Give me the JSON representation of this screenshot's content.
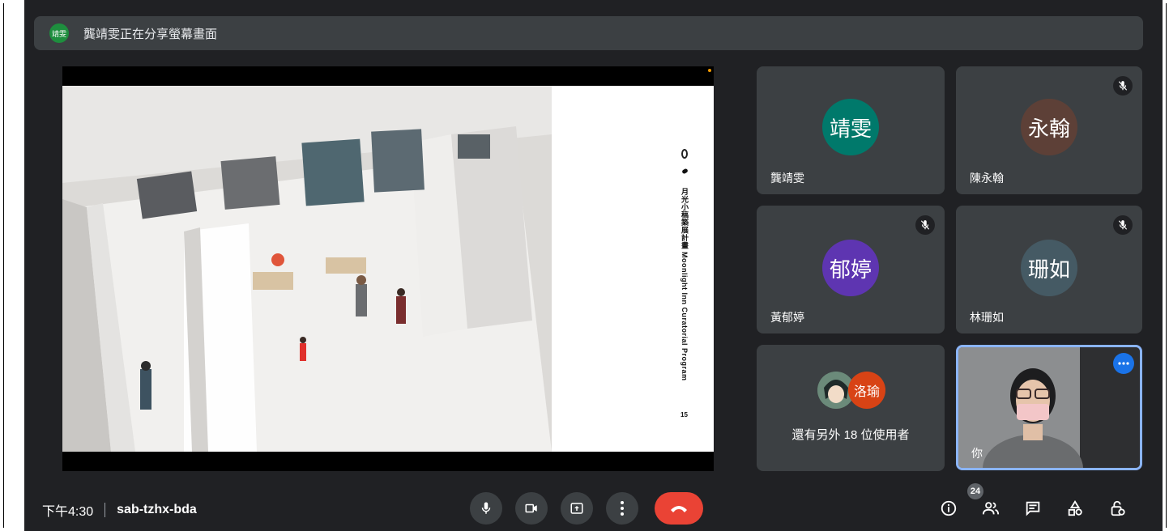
{
  "banner": {
    "avatar_text": "靖雯",
    "text": "龔靖雯正在分享螢幕畫面"
  },
  "slide": {
    "vertical_title": "月光小稿築展計畫 Moonlight Inn Curatorial Program",
    "page_number": "15"
  },
  "tiles": [
    {
      "avatar": "靖雯",
      "name": "龔靖雯",
      "color": "#00796b",
      "muted": false
    },
    {
      "avatar": "永翰",
      "name": "陳永翰",
      "color": "#5d4037",
      "muted": true
    },
    {
      "avatar": "郁婷",
      "name": "黃郁婷",
      "color": "#5e35b1",
      "muted": true
    },
    {
      "avatar": "珊如",
      "name": "林珊如",
      "color": "#455a64",
      "muted": true
    }
  ],
  "others": {
    "avatar_text": "洛瑜",
    "avatar_color": "#d84315",
    "text": "還有另外 18 位使用者"
  },
  "self_tile": {
    "name": "你"
  },
  "bottom": {
    "time": "下午4:30",
    "meeting_code": "sab-tzhx-bda",
    "participant_count": "24"
  },
  "icons": [
    "mic-icon",
    "camera-icon",
    "present-icon",
    "more-vert-icon",
    "hangup-icon",
    "info-icon",
    "people-icon",
    "chat-icon",
    "activities-icon",
    "host-controls-icon"
  ],
  "colors": {
    "background": "#202124",
    "tile": "#3c4043",
    "accent": "#8ab4f8",
    "danger": "#ea4335"
  }
}
